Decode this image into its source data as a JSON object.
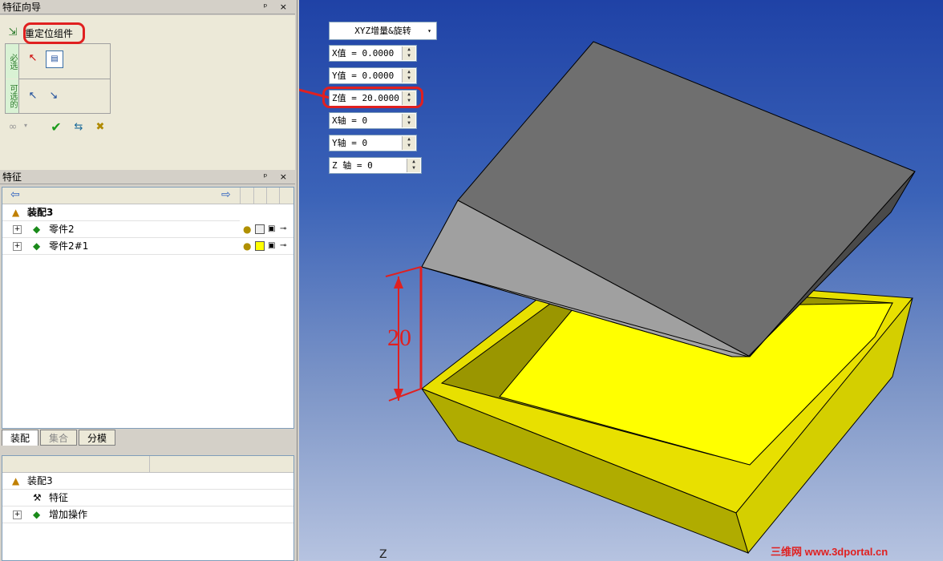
{
  "wizard": {
    "title": "特征向导",
    "step_label": "重定位组件",
    "side_tab_1": "必选",
    "side_tab_2": "可选的",
    "pin_close": "ᵖ ×"
  },
  "features": {
    "title": "特征",
    "pin_close": "ᵖ ×",
    "root": "装配3",
    "items": [
      {
        "label": "零件2"
      },
      {
        "label": "零件2#1"
      }
    ]
  },
  "tabs": [
    "装配",
    "集合",
    "分模"
  ],
  "assembly_tree": {
    "root": "装配3",
    "items": [
      {
        "label": "特征"
      },
      {
        "label": "增加操作"
      }
    ]
  },
  "transform": {
    "mode": "XYZ增量&旋转",
    "x_value": "X值 =  0.0000",
    "y_value": "Y值 =  0.0000",
    "z_value": "Z值 = 20.0000",
    "x_axis": "X轴 = 0",
    "y_axis": "Y轴 = 0",
    "z_axis": "Z 轴 = 0"
  },
  "annotation": {
    "dimension": "20"
  },
  "watermark": "三维网 www.3dportal.cn",
  "viewport_axis_hint": "Z",
  "colors": {
    "highlight": "#e02020",
    "tray_yellow": "#e8e000",
    "block_gray": "#7a7a7a"
  }
}
